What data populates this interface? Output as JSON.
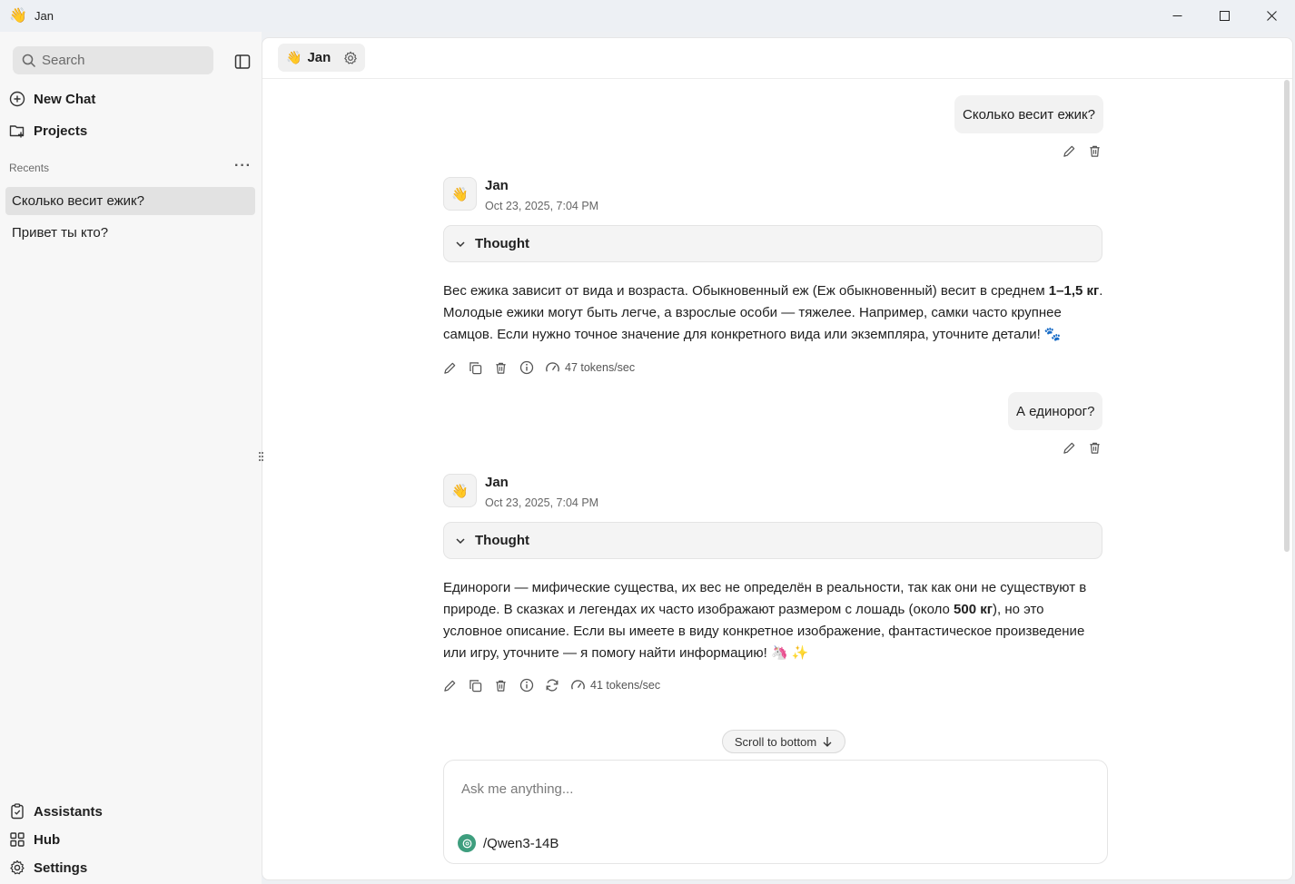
{
  "window": {
    "title": "Jan",
    "app_icon": "👋"
  },
  "sidebar": {
    "search_placeholder": "Search",
    "nav": [
      {
        "label": "New Chat",
        "icon": "plus-circle-icon"
      },
      {
        "label": "Projects",
        "icon": "folder-plus-icon"
      }
    ],
    "recents_label": "Recents",
    "recents_more": "···",
    "recents": [
      {
        "label": "Сколько весит ежик?",
        "active": true
      },
      {
        "label": "Привет ты кто?",
        "active": false
      }
    ],
    "bottom_nav": [
      {
        "label": "Assistants",
        "icon": "clipboard-icon"
      },
      {
        "label": "Hub",
        "icon": "grid-icon"
      },
      {
        "label": "Settings",
        "icon": "gear-icon"
      }
    ]
  },
  "header": {
    "assistant_emoji": "👋",
    "assistant_name": "Jan"
  },
  "messages": [
    {
      "role": "user",
      "text": "Сколько весит ежик?"
    },
    {
      "role": "assistant",
      "sender": "Jan",
      "avatar": "👋",
      "timestamp": "Oct 23, 2025, 7:04 PM",
      "thought_label": "Thought",
      "text_parts": [
        "Вес ежика зависит от вида и возраста. Обыкновенный еж (Еж обыкновенный) весит в среднем ",
        "1–1,5 кг",
        ". Молодые ежики могут быть легче, а взрослые особи — тяжелее. Например, самки часто крупнее самцов. Если нужно точное значение для конкретного вида или экземпляра, уточните детали! 🐾"
      ],
      "speed": "47 tokens/sec"
    },
    {
      "role": "user",
      "text": "А единорог?"
    },
    {
      "role": "assistant",
      "sender": "Jan",
      "avatar": "👋",
      "timestamp": "Oct 23, 2025, 7:04 PM",
      "thought_label": "Thought",
      "text_parts": [
        "Единороги — мифические существа, их вес не определён в реальности, так как они не существуют в природе. В сказках и легендах их часто изображают размером с лошадь (около ",
        "500 кг",
        "), но это условное описание. Если вы имеете в виду конкретное изображение, фантастическое произведение или игру, уточните — я помогу найти информацию! 🦄 ✨"
      ],
      "speed": "41 tokens/sec"
    }
  ],
  "scroll_to_bottom": "Scroll to bottom",
  "composer": {
    "placeholder": "Ask me anything...",
    "model": "/Qwen3-14B"
  },
  "colors": {
    "accent_model_dot": "#3e9e7e",
    "active_recent_bg": "#e2e2e2"
  }
}
